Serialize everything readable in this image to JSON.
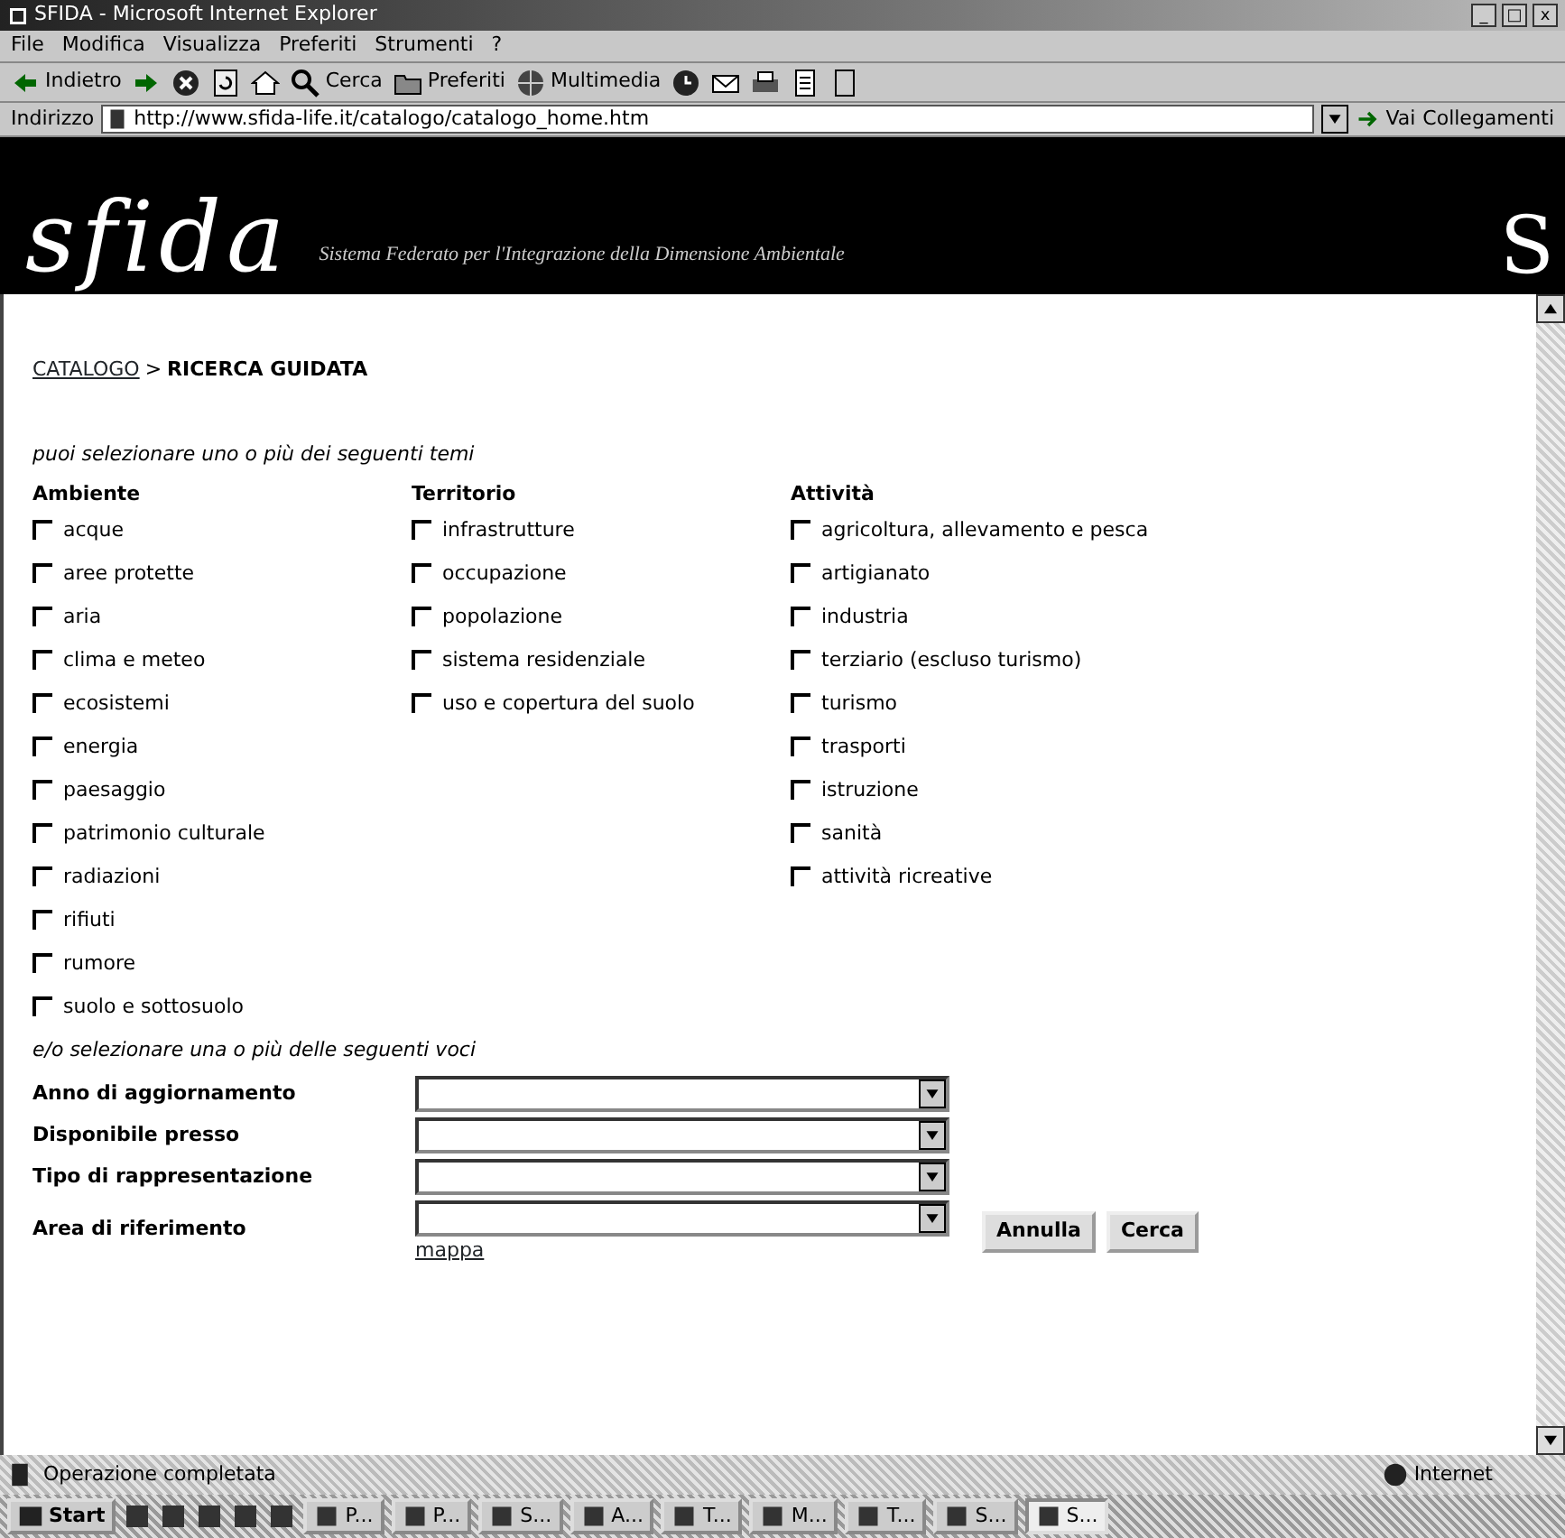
{
  "window": {
    "title": "SFIDA - Microsoft Internet Explorer",
    "controls": [
      "_",
      "□",
      "x"
    ]
  },
  "menu": [
    "File",
    "Modifica",
    "Visualizza",
    "Preferiti",
    "Strumenti",
    "?"
  ],
  "toolbar": [
    {
      "kind": "back",
      "label": "Indietro"
    },
    {
      "kind": "forward"
    },
    {
      "kind": "stop"
    },
    {
      "kind": "refresh"
    },
    {
      "kind": "home"
    },
    {
      "kind": "search",
      "label": "Cerca"
    },
    {
      "kind": "favorites",
      "label": "Preferiti"
    },
    {
      "kind": "media",
      "label": "Multimedia"
    },
    {
      "kind": "history"
    },
    {
      "kind": "mail"
    },
    {
      "kind": "print"
    },
    {
      "kind": "edit"
    },
    {
      "kind": "discuss"
    }
  ],
  "address": {
    "label": "Indirizzo",
    "url": "http://www.sfida-life.it/catalogo/catalogo_home.htm",
    "go": "Vai",
    "links": "Collegamenti"
  },
  "banner": {
    "logo": "sfida",
    "subtitle": "Sistema Federato per l'Integrazione della Dimensione Ambientale",
    "corner": "S"
  },
  "breadcrumb": {
    "link": "CATALOGO",
    "separator": ">",
    "current": "RICERCA GUIDATA"
  },
  "intro": "puoi selezionare uno o più dei seguenti temi",
  "themes": [
    {
      "heading": "Ambiente",
      "items": [
        {
          "label": "acque",
          "checked": false
        },
        {
          "label": "aree protette",
          "checked": false
        },
        {
          "label": "aria",
          "checked": false
        },
        {
          "label": "clima e meteo",
          "checked": false
        },
        {
          "label": "ecosistemi",
          "checked": false
        },
        {
          "label": "energia",
          "checked": false
        },
        {
          "label": "paesaggio",
          "checked": false
        },
        {
          "label": "patrimonio culturale",
          "checked": false
        },
        {
          "label": "radiazioni",
          "checked": false
        },
        {
          "label": "rifiuti",
          "checked": false
        },
        {
          "label": "rumore",
          "checked": false
        },
        {
          "label": "suolo e sottosuolo",
          "checked": false
        }
      ]
    },
    {
      "heading": "Territorio",
      "items": [
        {
          "label": "infrastrutture",
          "checked": false
        },
        {
          "label": "occupazione",
          "checked": false
        },
        {
          "label": "popolazione",
          "checked": false
        },
        {
          "label": "sistema residenziale",
          "checked": false
        },
        {
          "label": "uso e copertura del suolo",
          "checked": false
        }
      ]
    },
    {
      "heading": "Attività",
      "items": [
        {
          "label": "agricoltura, allevamento e pesca",
          "checked": false
        },
        {
          "label": "artigianato",
          "checked": false
        },
        {
          "label": "industria",
          "checked": false
        },
        {
          "label": "terziario (escluso turismo)",
          "checked": false
        },
        {
          "label": "turismo",
          "checked": false
        },
        {
          "label": "trasporti",
          "checked": false
        },
        {
          "label": "istruzione",
          "checked": false
        },
        {
          "label": "sanità",
          "checked": false
        },
        {
          "label": "attività ricreative",
          "checked": false
        }
      ]
    }
  ],
  "filters_intro": "e/o selezionare una o più delle seguenti voci",
  "filters": [
    {
      "label": "Anno di aggiornamento"
    },
    {
      "label": "Disponibile presso"
    },
    {
      "label": "Tipo di rappresentazione"
    },
    {
      "label": "Area di riferimento",
      "link": "mappa"
    }
  ],
  "buttons": [
    "Annulla",
    "Cerca"
  ],
  "status_bar": {
    "text": "Operazione completata",
    "zone": "Internet"
  },
  "taskbar": {
    "start": "Start",
    "tasks": [
      {
        "label": "P...",
        "selected": false
      },
      {
        "label": "P...",
        "selected": false
      },
      {
        "label": "S...",
        "selected": false
      },
      {
        "label": "A...",
        "selected": false
      },
      {
        "label": "T...",
        "selected": false
      },
      {
        "label": "M...",
        "selected": false
      },
      {
        "label": "T...",
        "selected": false
      },
      {
        "label": "S...",
        "selected": false
      },
      {
        "label": "S...",
        "selected": true
      }
    ]
  }
}
